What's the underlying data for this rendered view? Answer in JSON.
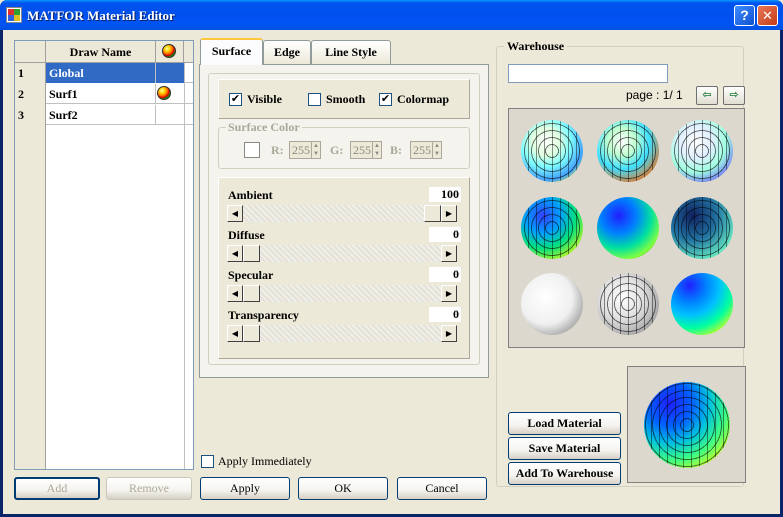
{
  "window": {
    "title": "MATFOR Material Editor",
    "help_label": "?",
    "close_label": "✕"
  },
  "grid": {
    "col_name": "Draw Name",
    "rows": [
      {
        "num": "1",
        "name": "Global",
        "selected": true
      },
      {
        "num": "2",
        "name": "Surf1",
        "has_color": true
      },
      {
        "num": "3",
        "name": "Surf2"
      }
    ]
  },
  "tabs": [
    {
      "label": "Surface"
    },
    {
      "label": "Edge"
    },
    {
      "label": "Line Style"
    }
  ],
  "surface": {
    "visible_label": "Visible",
    "visible_checked": true,
    "smooth_label": "Smooth",
    "smooth_checked": false,
    "colormap_label": "Colormap",
    "colormap_checked": true,
    "surface_color_title": "Surface Color",
    "r_label": "R:",
    "r_value": "255",
    "g_label": "G:",
    "g_value": "255",
    "b_label": "B:",
    "b_value": "255"
  },
  "sliders": [
    {
      "label": "Ambient",
      "value": "100",
      "fraction": 1.0
    },
    {
      "label": "Diffuse",
      "value": "0",
      "fraction": 0.0
    },
    {
      "label": "Specular",
      "value": "0",
      "fraction": 0.0
    },
    {
      "label": "Transparency",
      "value": "0",
      "fraction": 0.0
    }
  ],
  "apply_immediately": {
    "label": "Apply Immediately",
    "checked": false
  },
  "buttons": {
    "add": "Add",
    "remove": "Remove",
    "apply": "Apply",
    "ok": "OK",
    "cancel": "Cancel",
    "load_material": "Load Material",
    "save_material": "Save Material",
    "add_to_warehouse": "Add To Warehouse"
  },
  "warehouse": {
    "title": "Warehouse",
    "search_value": "",
    "page_text": "page : 1/ 1",
    "prev_icon": "prev-arrow-icon",
    "next_icon": "next-arrow-icon"
  },
  "colors": {
    "title_blue": "#0054e3",
    "selection": "#316ac5",
    "face": "#ece9d8",
    "tab_highlight": "#ffc83c"
  }
}
